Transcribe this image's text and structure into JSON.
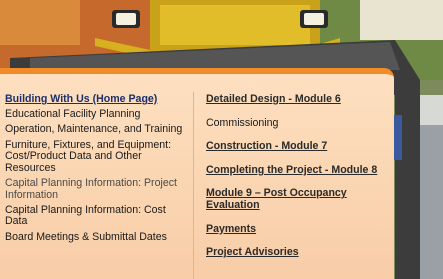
{
  "left_links": [
    {
      "label": "Building With Us (Home Page)",
      "style": "heading"
    },
    {
      "label": "Educational Facility Planning",
      "style": "plain"
    },
    {
      "label": "Operation, Maintenance, and Training",
      "style": "plain"
    },
    {
      "label": "Furniture, Fixtures, and Equipment: Cost/Product Data and Other Resources",
      "style": "plain"
    },
    {
      "label": "Capital Planning Information: Project Information",
      "style": "muted"
    },
    {
      "label": "Capital Planning Information: Cost Data",
      "style": "plain"
    },
    {
      "label": "Board Meetings & Submittal Dates",
      "style": "plain"
    }
  ],
  "right_links": [
    {
      "label": "Detailed Design - Module 6",
      "style": "heading"
    },
    {
      "label": "Commissioning",
      "style": "plain"
    },
    {
      "label": "Construction - Module 7",
      "style": "heading"
    },
    {
      "label": "Completing the Project - Module 8",
      "style": "heading"
    },
    {
      "label": "Module 9 – Post Occupancy Evaluation",
      "style": "heading"
    },
    {
      "label": "Payments",
      "style": "heading"
    },
    {
      "label": "Project Advisories",
      "style": "heading"
    }
  ],
  "colors": {
    "accent": "#f28c28",
    "link": "#1b2f6b",
    "panel": "#fbd7b4"
  }
}
